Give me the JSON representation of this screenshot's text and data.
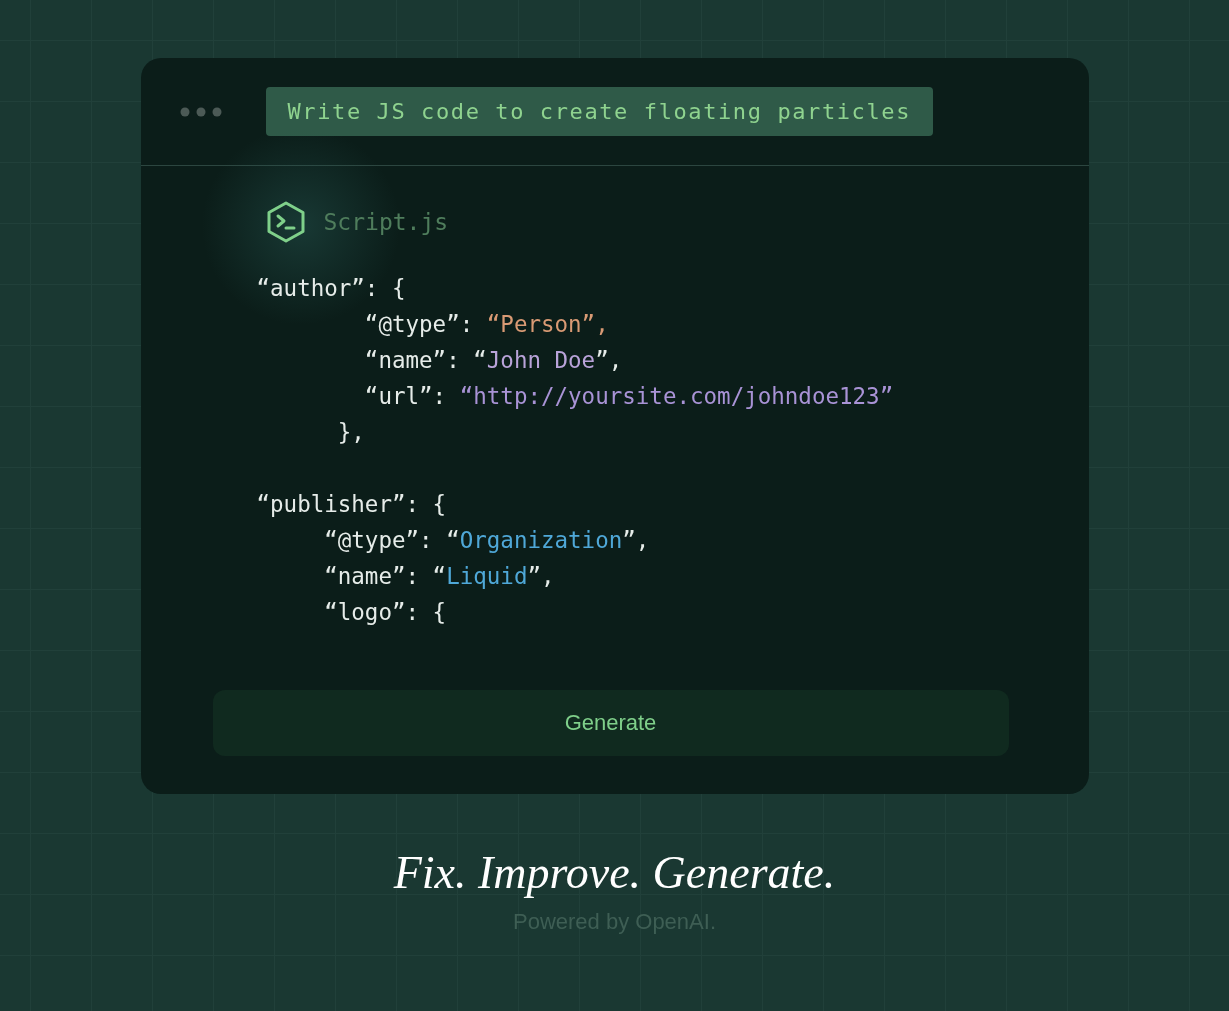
{
  "prompt": "Write JS code to create floating particles",
  "file": {
    "name": "Script.js"
  },
  "code_blocks": [
    {
      "lines": [
        [
          {
            "text": "“author”: {",
            "color": "#e6ece9"
          }
        ],
        [
          {
            "text": "        “@type”: ",
            "color": "#e6ece9"
          },
          {
            "text": "“Person”,",
            "color": "#d99a74"
          }
        ],
        [
          {
            "text": "        “name”: “",
            "color": "#e6ece9"
          },
          {
            "text": "John Doe",
            "color": "#b9a3d9"
          },
          {
            "text": "”,",
            "color": "#e6ece9"
          }
        ],
        [
          {
            "text": "        “url”: ",
            "color": "#e6ece9"
          },
          {
            "text": "“http://yoursite.com/johndoe123”",
            "color": "#a993d6"
          }
        ],
        [
          {
            "text": "      },",
            "color": "#e6ece9"
          }
        ]
      ]
    },
    {
      "lines": [
        [
          {
            "text": "“publisher”: {",
            "color": "#e6ece9"
          }
        ],
        [
          {
            "text": "     “@type”: “",
            "color": "#e6ece9"
          },
          {
            "text": "Organization",
            "color": "#4fa8d8"
          },
          {
            "text": "”,",
            "color": "#e6ece9"
          }
        ],
        [
          {
            "text": "     “name”: “",
            "color": "#e6ece9"
          },
          {
            "text": "Liquid",
            "color": "#4fa8d8"
          },
          {
            "text": "”,",
            "color": "#e6ece9"
          }
        ],
        [
          {
            "text": "     “logo”: {",
            "color": "#e6ece9"
          }
        ]
      ]
    }
  ],
  "button": "Generate",
  "tagline": "Fix. Improve. Generate.",
  "footer": "Powered by OpenAI."
}
